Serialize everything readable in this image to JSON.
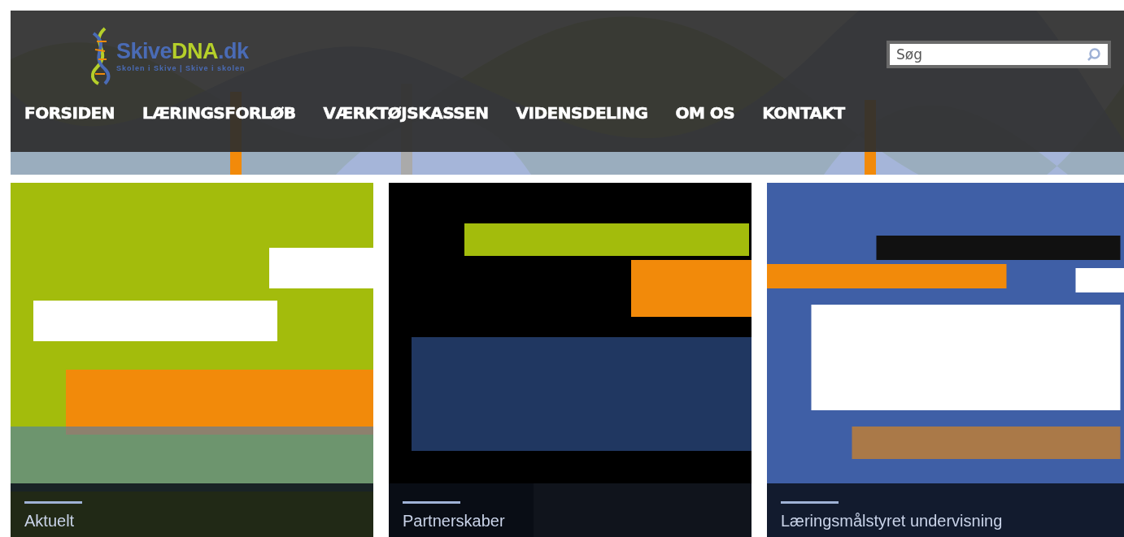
{
  "logo": {
    "name_parts": [
      "Skive",
      "DNA",
      ".dk"
    ],
    "tagline": "Skolen i Skive | Skive i skolen"
  },
  "search": {
    "placeholder": "Søg"
  },
  "nav": [
    {
      "label": "FORSIDEN"
    },
    {
      "label": "LÆRINGSFORLØB"
    },
    {
      "label": "VÆRKTØJSKASSEN"
    },
    {
      "label": "VIDENSDELING"
    },
    {
      "label": "OM OS"
    },
    {
      "label": "KONTAKT"
    }
  ],
  "cards": [
    {
      "kind": "picture",
      "caption": "Aktuelt"
    },
    {
      "kind": "picture",
      "caption": "Partnerskaber"
    },
    {
      "kind": "picture",
      "caption": "Læringsmålstyret undervisning"
    }
  ]
}
